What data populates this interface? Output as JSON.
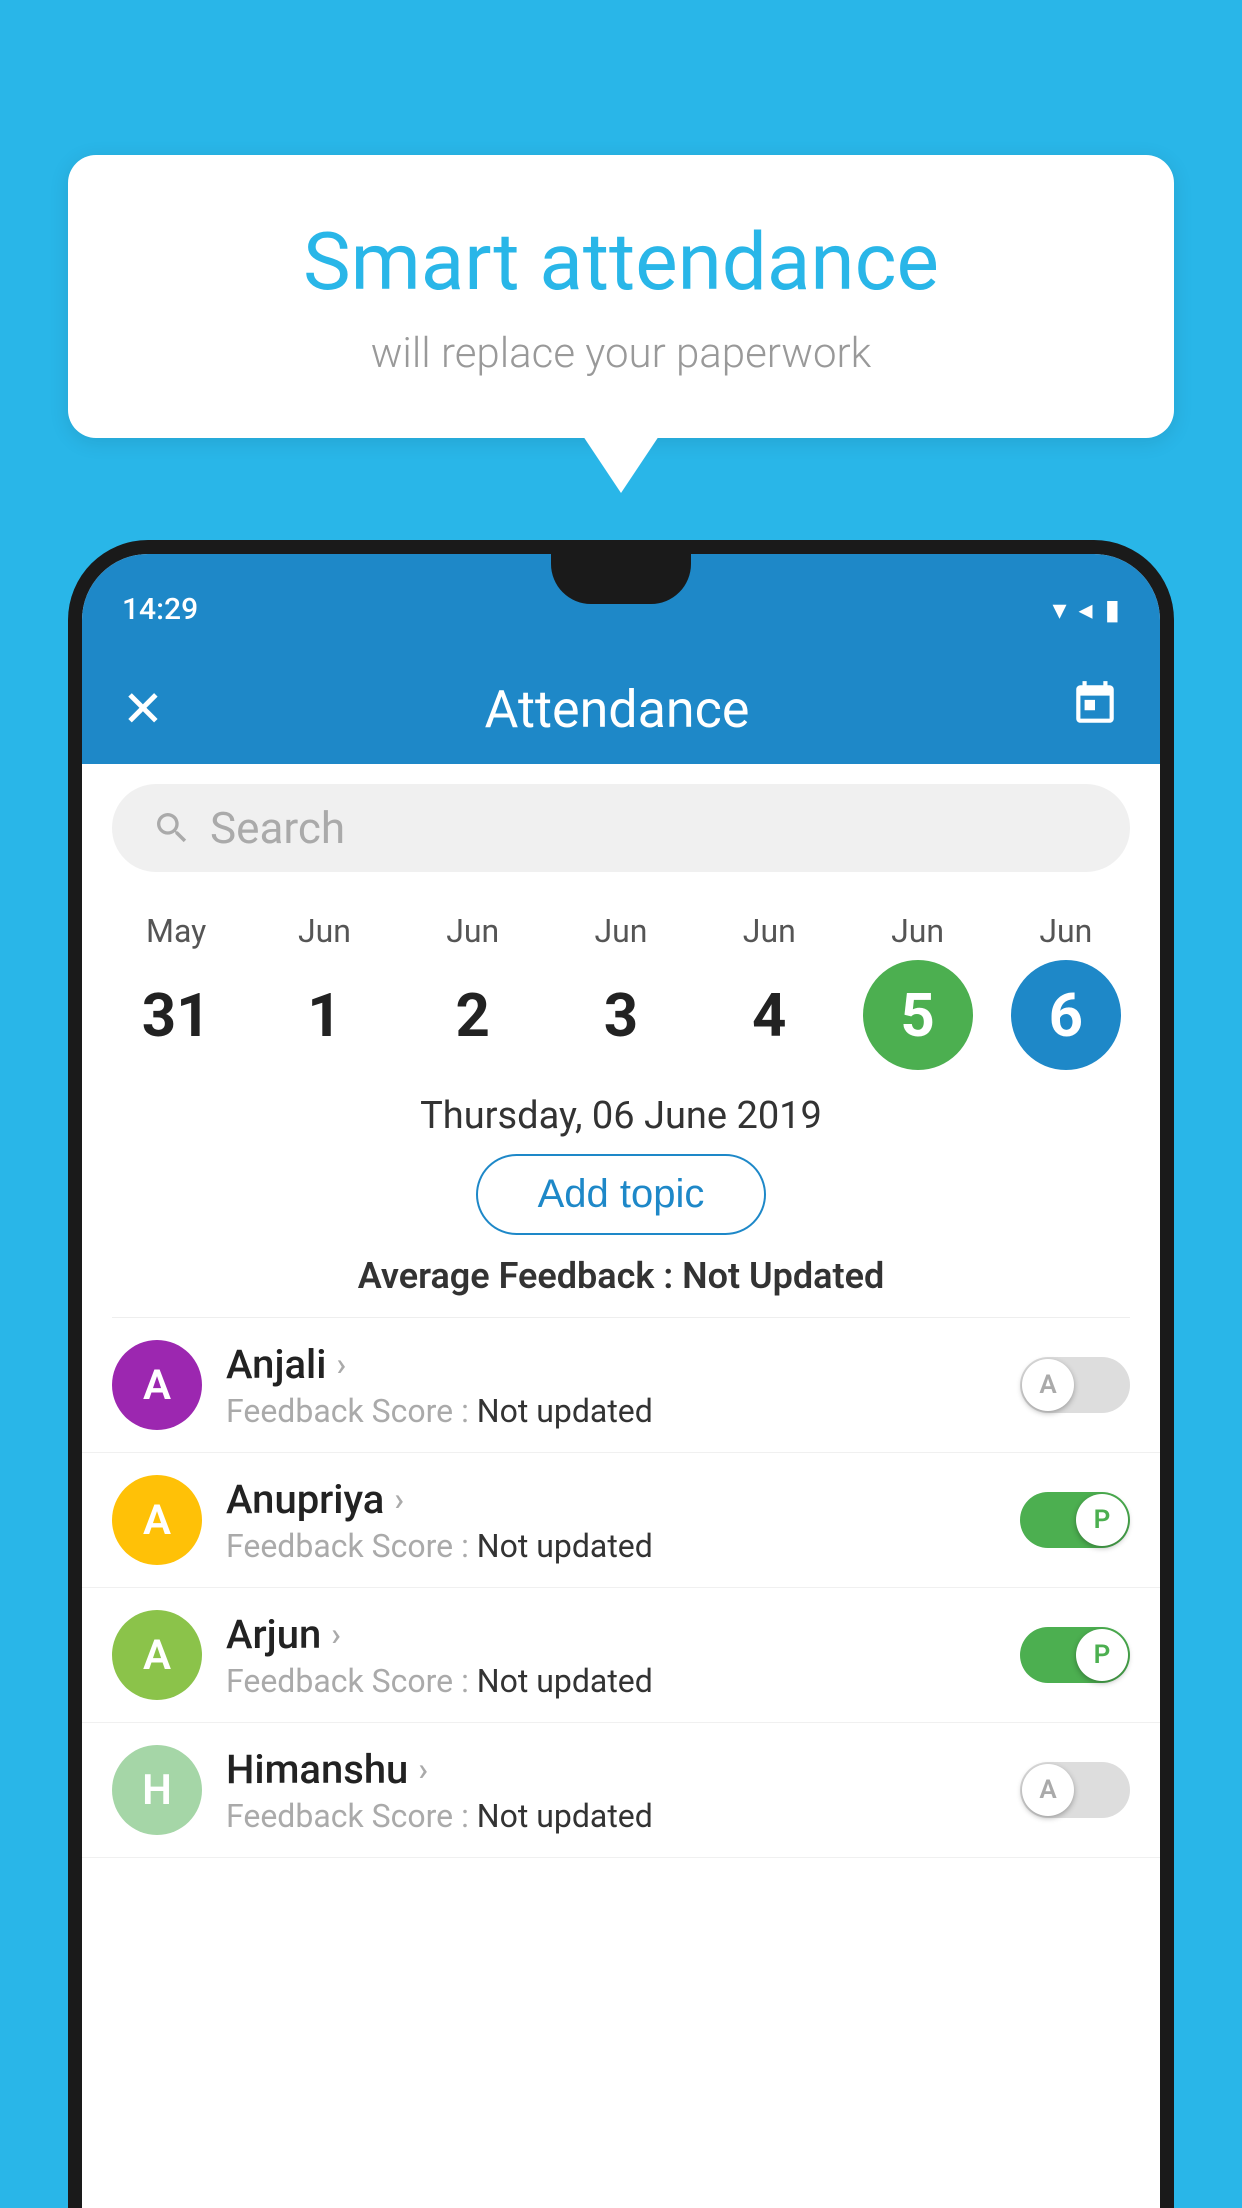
{
  "background_color": "#29B6E8",
  "speech_bubble": {
    "title": "Smart attendance",
    "subtitle": "will replace your paperwork"
  },
  "phone": {
    "status_bar": {
      "time": "14:29"
    },
    "header": {
      "title": "Attendance",
      "close_label": "×",
      "calendar_icon": "📅"
    },
    "search": {
      "placeholder": "Search"
    },
    "date_strip": {
      "dates": [
        {
          "month": "May",
          "day": "31",
          "state": "normal"
        },
        {
          "month": "Jun",
          "day": "1",
          "state": "normal"
        },
        {
          "month": "Jun",
          "day": "2",
          "state": "normal"
        },
        {
          "month": "Jun",
          "day": "3",
          "state": "normal"
        },
        {
          "month": "Jun",
          "day": "4",
          "state": "normal"
        },
        {
          "month": "Jun",
          "day": "5",
          "state": "today"
        },
        {
          "month": "Jun",
          "day": "6",
          "state": "selected"
        }
      ]
    },
    "selected_date_label": "Thursday, 06 June 2019",
    "add_topic_label": "Add topic",
    "avg_feedback_label": "Average Feedback : ",
    "avg_feedback_value": "Not Updated",
    "students": [
      {
        "name": "Anjali",
        "avatar_letter": "A",
        "avatar_color": "#9C27B0",
        "feedback_label": "Feedback Score : ",
        "feedback_value": "Not updated",
        "toggle_state": "off",
        "toggle_letter": "A"
      },
      {
        "name": "Anupriya",
        "avatar_letter": "A",
        "avatar_color": "#FFC107",
        "feedback_label": "Feedback Score : ",
        "feedback_value": "Not updated",
        "toggle_state": "on",
        "toggle_letter": "P"
      },
      {
        "name": "Arjun",
        "avatar_letter": "A",
        "avatar_color": "#8BC34A",
        "feedback_label": "Feedback Score : ",
        "feedback_value": "Not updated",
        "toggle_state": "on",
        "toggle_letter": "P"
      },
      {
        "name": "Himanshu",
        "avatar_letter": "H",
        "avatar_color": "#A5D6A7",
        "feedback_label": "Feedback Score : ",
        "feedback_value": "Not updated",
        "toggle_state": "off",
        "toggle_letter": "A"
      }
    ]
  }
}
